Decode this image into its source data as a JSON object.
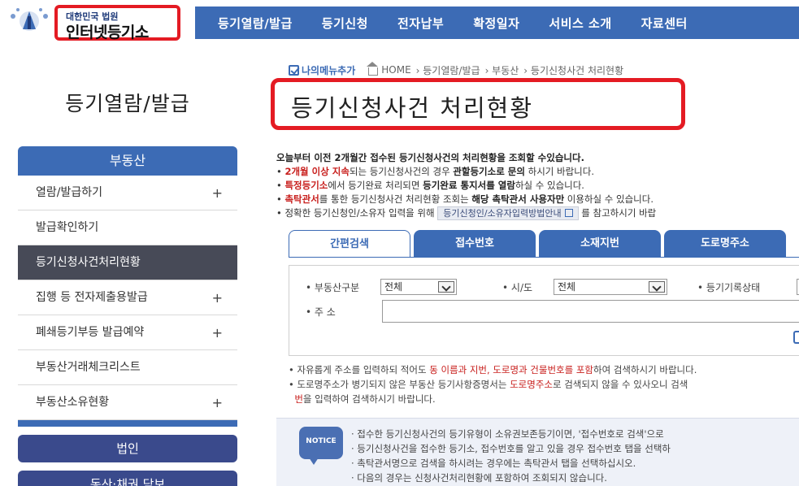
{
  "header": {
    "logo_sub": "대한민국 법원",
    "logo_main": "인터넷등기소",
    "nav": [
      "등기열람/발급",
      "등기신청",
      "전자납부",
      "확정일자",
      "서비스 소개",
      "자료센터"
    ]
  },
  "sidebar": {
    "title": "등기열람/발급",
    "section_head": "부동산",
    "items": [
      {
        "label": "열람/발급하기",
        "plus": "+"
      },
      {
        "label": "발급확인하기",
        "plus": ""
      },
      {
        "label": "등기신청사건처리현황",
        "plus": ""
      },
      {
        "label": "집행 등 전자제출용발급",
        "plus": "+"
      },
      {
        "label": "폐쇄등기부등 발급예약",
        "plus": "+"
      },
      {
        "label": "부동산거래체크리스트",
        "plus": ""
      },
      {
        "label": "부동산소유현황",
        "plus": "+"
      }
    ],
    "sections": [
      "법인",
      "동산·채권 담보"
    ]
  },
  "breadcrumb": {
    "mymenu": "나의메뉴추가",
    "path": [
      "HOME",
      "› 등기열람/발급",
      "› 부동산",
      "› 등기신청사건 처리현황"
    ]
  },
  "page_title": "등기신청사건 처리현황",
  "description": {
    "lead": "오늘부터 이전 2개월간 접수된 등기신청사건의 처리현황을 조회할 수있습니다.",
    "bullet1": {
      "a": "2개월 이상 지속",
      "b": "되는 등기신청사건의 경우 ",
      "c": "관할등기소로 문의",
      "d": " 하시기 바랍니다."
    },
    "bullet2": {
      "a": "특정등기소",
      "b": "에서 등기완료 처리되면 ",
      "c": "등기완료 통지서를 열람",
      "d": "하실 수 있습니다."
    },
    "bullet3": {
      "a": "촉탁관서",
      "b": "를 통한 등기신청사건 처리현황 조회는 ",
      "c": "해당 촉탁관서 사용자만",
      "d": " 이용하실 수 있습니다."
    },
    "bullet4": {
      "a": "정확한 등기신청인/소유자 입력을 위해 ",
      "btn": "등기신청인/소유자입력방법안내",
      "d": " 를 참고하시기 바랍"
    }
  },
  "tabs": [
    "간편검색",
    "접수번호",
    "소재지번",
    "도로명주소"
  ],
  "search": {
    "type_label": "부동산구분",
    "type_value": "전체",
    "city_label": "시/도",
    "city_value": "전체",
    "status_label": "등기기록상태",
    "address_label": "주 소"
  },
  "notes": {
    "n1": {
      "a": "자유롭게 주소를 입력하되 적어도 ",
      "b": "동 이름과 지번, 도로명과 건물번호를 포함",
      "c": "하여 검색하시기 바랍니다."
    },
    "n2": {
      "a": "도로명주소가 병기되지 않은 부동산 등기사항증명서는 ",
      "b": "도로명주소",
      "c": "로 검색되지 않을 수 있사오니 검색"
    },
    "n3": {
      "a": "번",
      "b": "을 입력하여 검색하시기 바랍니다."
    }
  },
  "notice": {
    "icon_label": "NOTICE",
    "lines": [
      "· 접수한 등기신청사건의 등기유형이 소유권보존등기이면, '접수번호로 검색'으로",
      "· 등기신청사건을 접수한 등기소, 접수번호를 알고 있을 경우 접수번호 탭을 선택하",
      "· 촉탁관서명으로 검색을 하시려는 경우에는 촉탁관서 탭을 선택하십시오.",
      "· 다음의 경우는 신청사건처리현황에 포함하여 조회되지 않습니다."
    ]
  },
  "colors": {
    "brand": "#3c6bb5",
    "highlight": "#e41b23",
    "sidebar_active": "#474a57"
  }
}
